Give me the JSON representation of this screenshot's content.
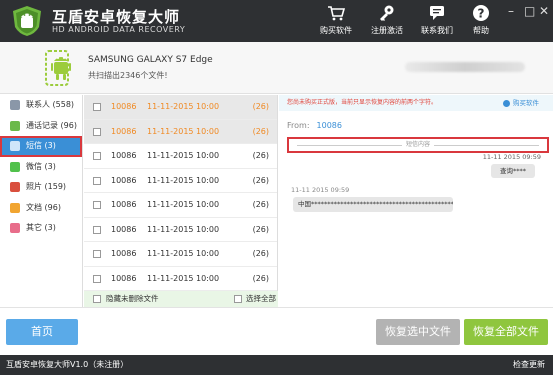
{
  "app": {
    "title": "互盾安卓恢复大师",
    "subtitle": "HD ANDROID DATA RECOVERY"
  },
  "toolbar": [
    {
      "icon": "cart-icon",
      "label": "购买软件"
    },
    {
      "icon": "key-icon",
      "label": "注册激活"
    },
    {
      "icon": "chat-icon",
      "label": "联系我们"
    },
    {
      "icon": "help-icon",
      "label": "帮助"
    }
  ],
  "window": {
    "shirt": "—",
    "minimize": "–",
    "maximize": "□",
    "close": "✕"
  },
  "device": {
    "name": "SAMSUNG  GALAXY S7 Edge",
    "summary": "共扫描出2346个文件!"
  },
  "sidebar": {
    "items": [
      {
        "label": "联系人 (558)",
        "color": "#8a97a8"
      },
      {
        "label": "通话记录 (96)",
        "color": "#6bb94a"
      },
      {
        "label": "短信 (3)",
        "color": "#4aa0e0"
      },
      {
        "label": "微信 (3)",
        "color": "#51c14b"
      },
      {
        "label": "照片 (159)",
        "color": "#d94f3d"
      },
      {
        "label": "文档 (96)",
        "color": "#f1a531"
      },
      {
        "label": "其它 (3)",
        "color": "#e86d8a"
      }
    ]
  },
  "messages": {
    "rows": [
      {
        "number": "10086",
        "date": "11-11-2015 10:00",
        "count": "(26)"
      },
      {
        "number": "10086",
        "date": "11-11-2015 10:00",
        "count": "(26)"
      },
      {
        "number": "10086",
        "date": "11-11-2015 10:00",
        "count": "(26)"
      },
      {
        "number": "10086",
        "date": "11-11-2015 10:00",
        "count": "(26)"
      },
      {
        "number": "10086",
        "date": "11-11-2015 10:00",
        "count": "(26)"
      },
      {
        "number": "10086",
        "date": "11-11-2015 10:00",
        "count": "(26)"
      },
      {
        "number": "10086",
        "date": "11-11-2015 10:00",
        "count": "(26)"
      },
      {
        "number": "10086",
        "date": "11-11-2015 10:00",
        "count": "(26)"
      }
    ],
    "hide_deleted": "隐藏未删除文件",
    "select_all": "选择全部"
  },
  "detail": {
    "notice": "您尚未购买正式版，当前只显示恢复内容的前两个字符。",
    "buy": "购买软件",
    "from_label": "From:",
    "from_value": "10086",
    "divider_label": "短信内容",
    "ts_right": "11-11 2015 09:59",
    "bubble_right": "查询****",
    "ts_left": "11-11 2015 09:59",
    "bubble_left": "中国**************************************************"
  },
  "buttons": {
    "home": "首页",
    "recover_selected": "恢复选中文件",
    "recover_all": "恢复全部文件"
  },
  "status": {
    "version": "互盾安卓恢复大师V1.0（未注册）",
    "update": "检查更新"
  }
}
